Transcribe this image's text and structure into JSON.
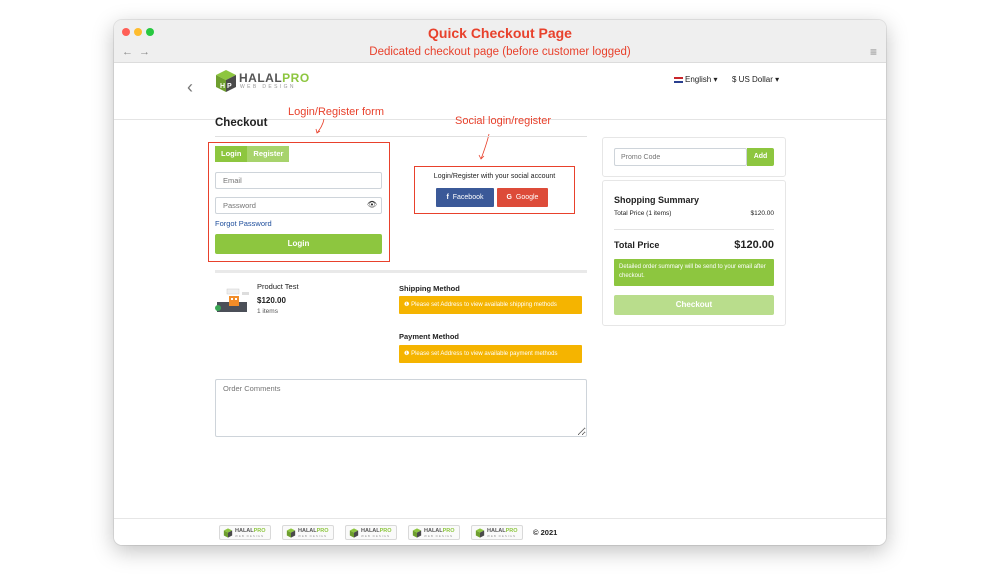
{
  "window": {
    "title": "Quick Checkout Page",
    "subtitle": "Dedicated checkout page (before customer logged)"
  },
  "header": {
    "logo_name": "HALAL",
    "logo_name_accent": "PRO",
    "logo_sub": "WEB DESIGN",
    "language": "English",
    "currency": "$ US Dollar"
  },
  "annotations": {
    "login_form": "Login/Register form",
    "social_login": "Social login/register"
  },
  "checkout": {
    "title": "Checkout",
    "tabs": [
      "Login",
      "Register"
    ],
    "email_placeholder": "Email",
    "password_placeholder": "Password",
    "forgot_password": "Forgot Password",
    "login_button": "Login"
  },
  "social": {
    "prompt": "Login/Register with your social account",
    "facebook": "Facebook",
    "google": "Google"
  },
  "product": {
    "name": "Product Test",
    "price": "$120.00",
    "qty": "1 items"
  },
  "shipping": {
    "label": "Shipping Method",
    "alert": "Please set Address to view available shipping methods"
  },
  "payment": {
    "label": "Payment Method",
    "alert": "Please set Address to view available payment methods"
  },
  "comments": {
    "placeholder": "Order Comments"
  },
  "promo": {
    "placeholder": "Promo Code",
    "button": "Add"
  },
  "summary": {
    "title": "Shopping Summary",
    "row_label": "Total Price (1 items)",
    "row_value": "$120.00",
    "total_label": "Total Price",
    "total_value": "$120.00",
    "note": "Detailed order summary will be send to your email after checkout.",
    "checkout_button": "Checkout"
  },
  "footer": {
    "copyright": "© 2021"
  },
  "colors": {
    "accent_green": "#8dc63f",
    "annotation_red": "#e8412c",
    "alert_amber": "#f5b400",
    "facebook": "#3b5998",
    "google": "#dd4b39"
  }
}
